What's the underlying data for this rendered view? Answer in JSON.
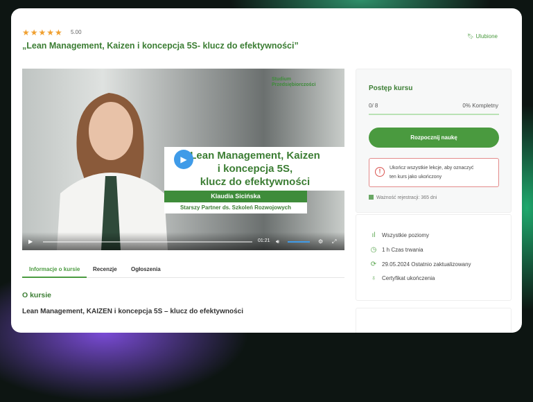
{
  "course": {
    "stars": "★★★★★",
    "rating": "5.00",
    "title": "„Lean Management, Kaizen i koncepcja 5S- klucz do efektywności”",
    "favorite_label": "Ulubione"
  },
  "video": {
    "logo_line1": "Studium",
    "logo_line2": "Przedsiębiorczości",
    "headline1": "Lean Management, Kaizen",
    "headline2": "i koncepcja 5S,",
    "headline3": "klucz do efektywności",
    "presenter": "Klaudia Sicińska",
    "role": "Starszy Partner ds. Szkoleń Rozwojowych",
    "time": "01:21"
  },
  "tabs": [
    "Informacje o kursie",
    "Recenzje",
    "Ogłoszenia"
  ],
  "about": {
    "heading": "O kursie",
    "text": "Lean Management, KAIZEN i koncepcja 5S – klucz do efektywności"
  },
  "progress": {
    "heading": "Postęp kursu",
    "count": "0/ 8",
    "percent_label": "0% Kompletny",
    "percent": 0,
    "start_button": "Rozpocznij naukę",
    "warning_line1": "Ukończ wszystkie lekcje, aby oznaczyć",
    "warning_line2": "ten kurs jako ukończony",
    "validity": "Ważność rejestracji: 365 dni"
  },
  "meta": [
    {
      "icon": "bar-chart-icon",
      "text": "Wszystkie poziomy"
    },
    {
      "icon": "clock-icon",
      "text": "1 h  Czas trwania"
    },
    {
      "icon": "refresh-icon",
      "text": "29.05.2024 Ostatnio zaktualizowany"
    },
    {
      "icon": "certificate-icon",
      "text": "Certyfikat ukończenia"
    }
  ]
}
